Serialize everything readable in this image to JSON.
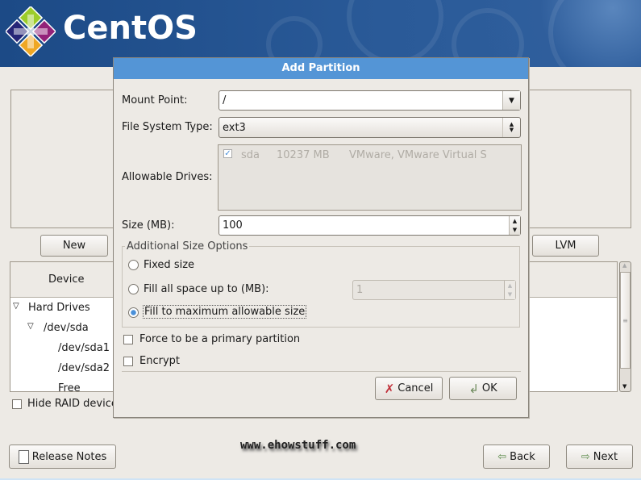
{
  "brand": {
    "name": "CentOS"
  },
  "main": {
    "new_label": "New",
    "lvm_label": "LVM",
    "tree": {
      "header": "Device",
      "items": [
        "Hard Drives",
        "/dev/sda",
        "/dev/sda1",
        "/dev/sda2",
        "Free"
      ]
    },
    "hide_raid_label": "Hide RAID device"
  },
  "dialog": {
    "title": "Add Partition",
    "mount_point": {
      "label": "Mount Point:",
      "value": "/"
    },
    "fs_type": {
      "label": "File System Type:",
      "value": "ext3"
    },
    "drives": {
      "label": "Allowable Drives:",
      "rows": [
        {
          "checked": true,
          "name": "sda",
          "size": "10237 MB",
          "model": "VMware, VMware Virtual S"
        }
      ]
    },
    "size": {
      "label": "Size (MB):",
      "value": "100"
    },
    "size_options": {
      "legend": "Additional Size Options",
      "fixed": "Fixed size",
      "fill_upto": "Fill all space up to (MB):",
      "fill_upto_value": "1",
      "fill_max": "Fill to maximum allowable size",
      "selected": "fill_max"
    },
    "primary_label": "Force to be a primary partition",
    "primary_checked": false,
    "encrypt_label": "Encrypt",
    "encrypt_checked": false,
    "cancel_label": "Cancel",
    "ok_label": "OK"
  },
  "footer": {
    "release_notes": "Release Notes",
    "back": "Back",
    "next": "Next",
    "watermark": "www.ehowstuff.com"
  },
  "colors": {
    "title_bar": "#5495d6",
    "banner": "#2a5a98"
  }
}
